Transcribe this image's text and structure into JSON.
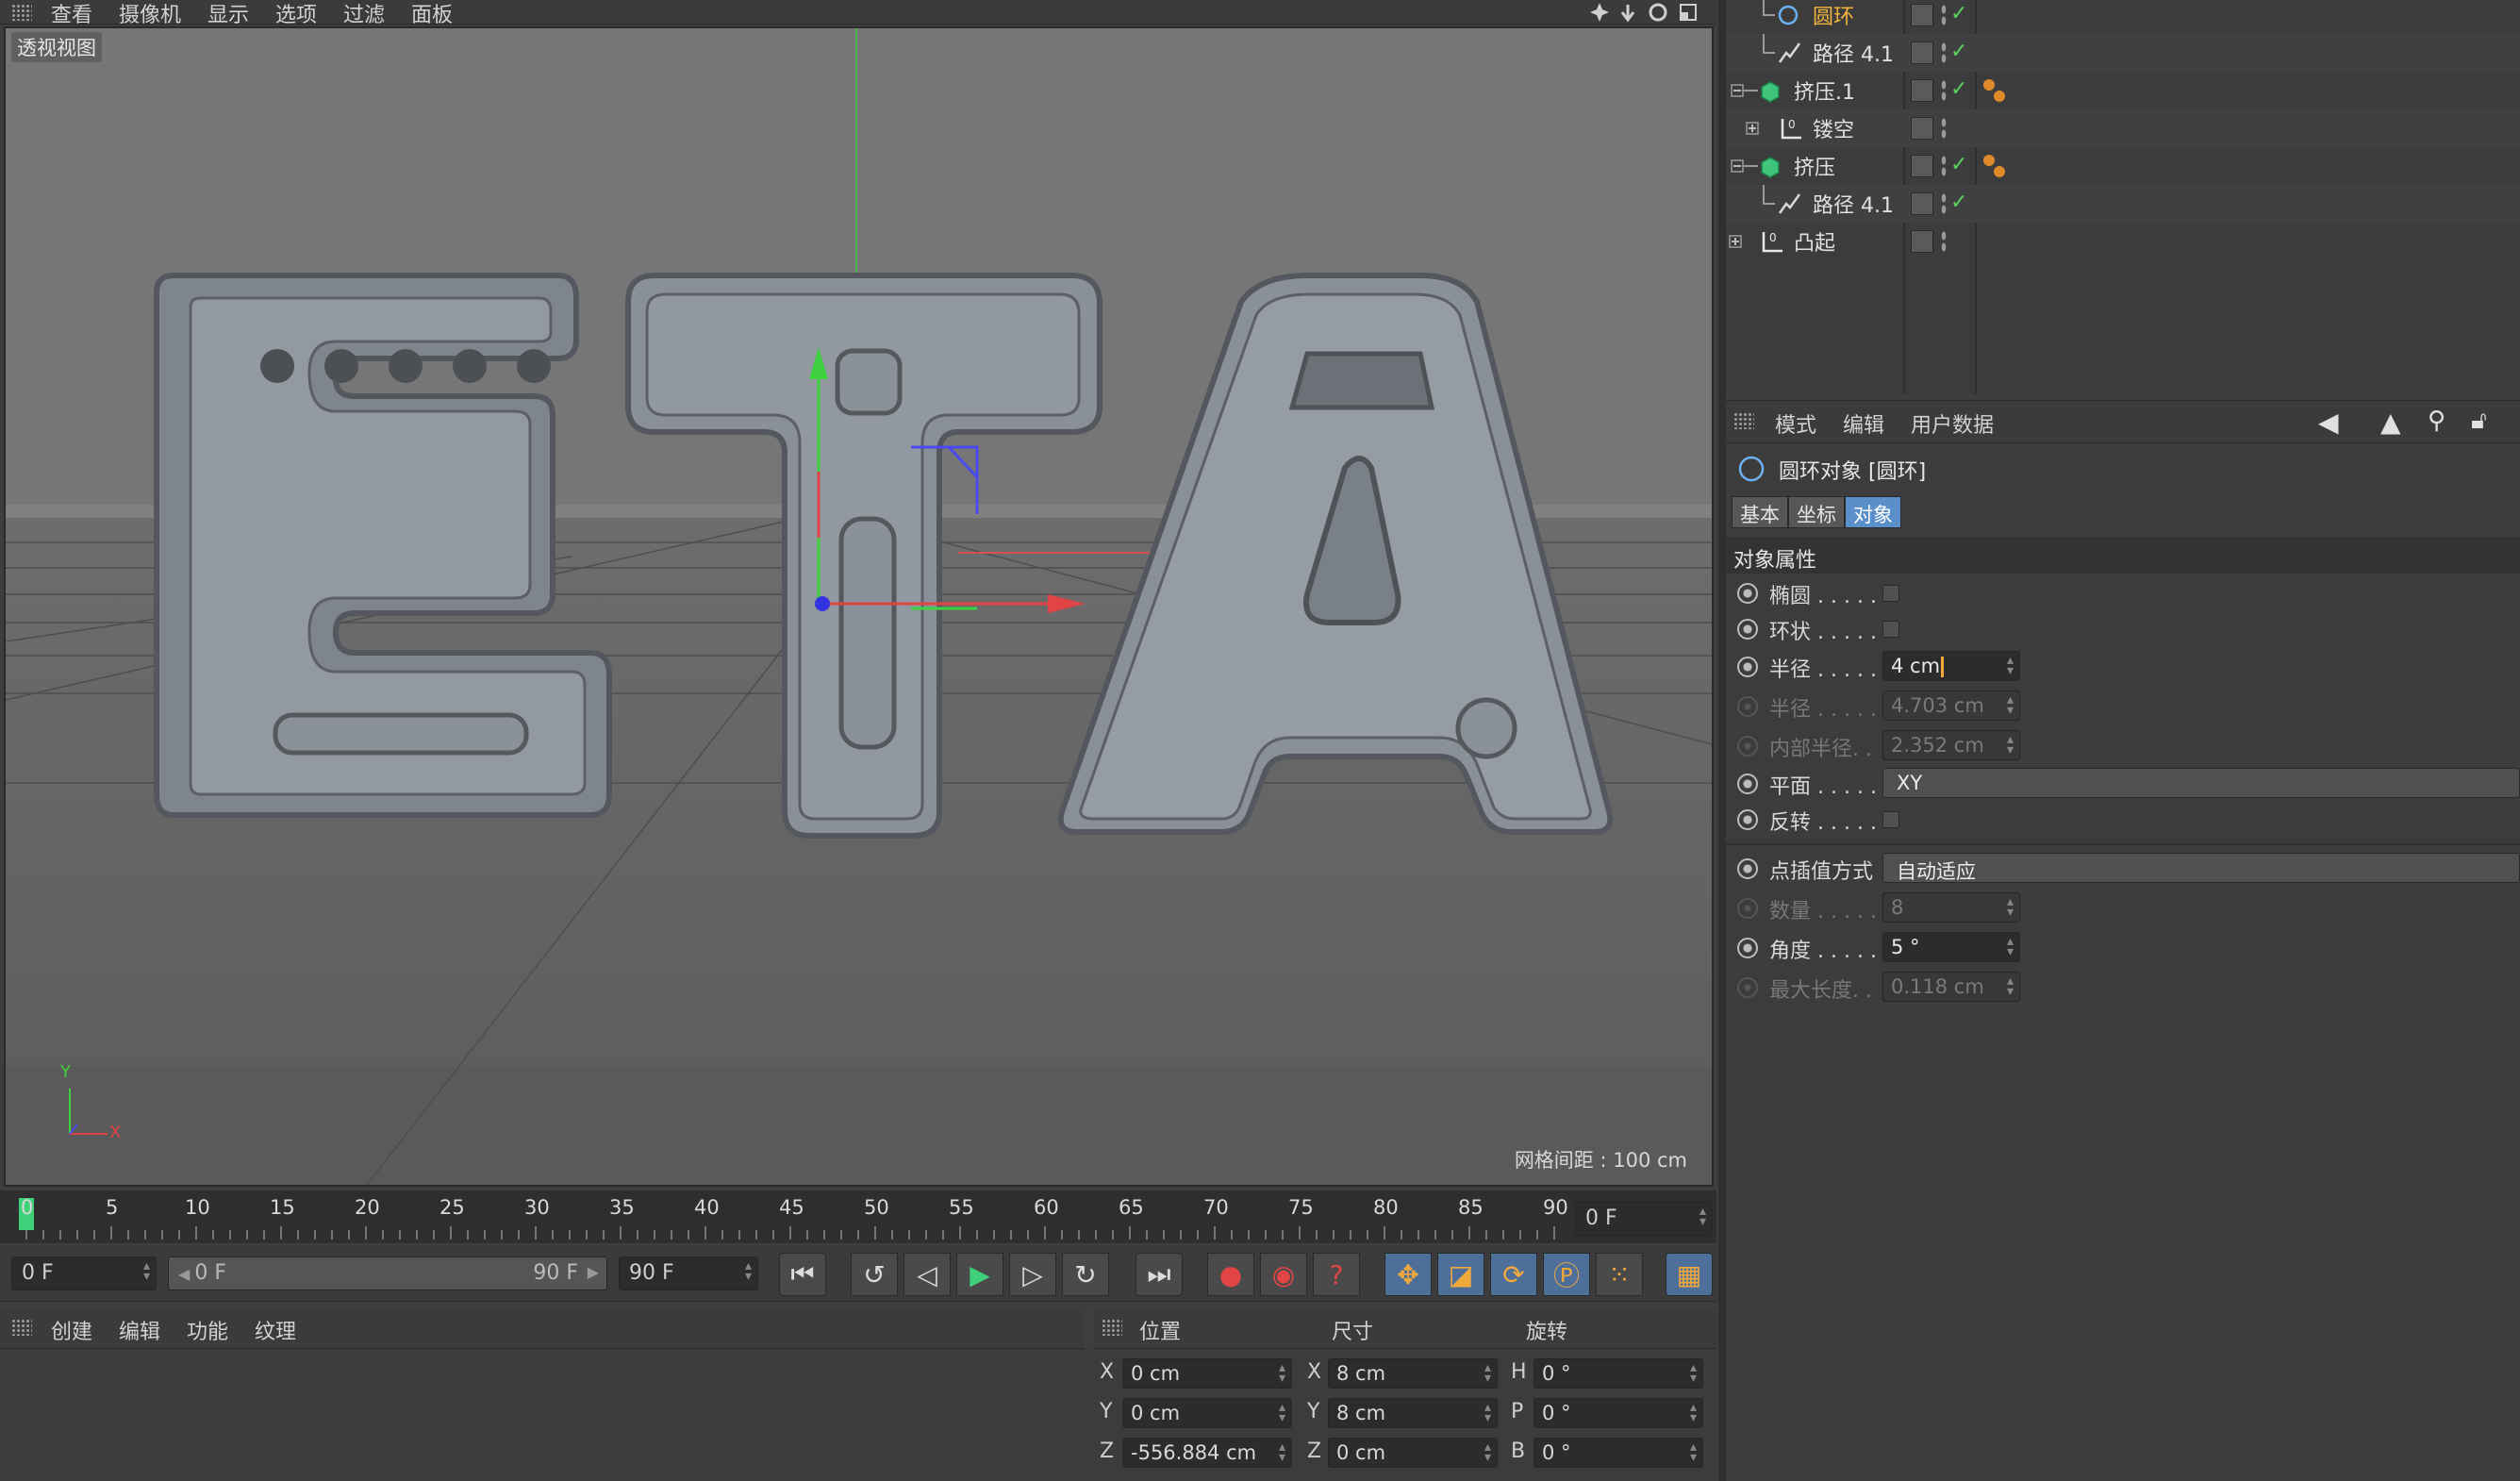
{
  "menubar": {
    "items": [
      "查看",
      "摄像机",
      "显示",
      "选项",
      "过滤",
      "面板"
    ]
  },
  "viewport": {
    "label": "透视视图",
    "grid_spacing": "网格间距 : 100 cm",
    "letters": "ETA",
    "axis": {
      "y": "Y",
      "x": "X"
    }
  },
  "timeline": {
    "ticks": [
      "0",
      "5",
      "10",
      "15",
      "20",
      "25",
      "30",
      "35",
      "40",
      "45",
      "50",
      "55",
      "60",
      "65",
      "70",
      "75",
      "80",
      "85",
      "90"
    ],
    "current_frame": "0 F",
    "start_frame": "0 F",
    "range_start": "0 F",
    "range_end": "90 F",
    "end_frame": "90 F"
  },
  "materials": {
    "menu": [
      "创建",
      "编辑",
      "功能",
      "纹理"
    ]
  },
  "coords": {
    "headers": {
      "position": "位置",
      "size": "尺寸",
      "rotation": "旋转"
    },
    "rows": [
      {
        "axis": "X",
        "pos": "0 cm",
        "size_axis": "X",
        "size": "8 cm",
        "rot_axis": "H",
        "rot": "0 °"
      },
      {
        "axis": "Y",
        "pos": "0 cm",
        "size_axis": "Y",
        "size": "8 cm",
        "rot_axis": "P",
        "rot": "0 °"
      },
      {
        "axis": "Z",
        "pos": "-556.884 cm",
        "size_axis": "Z",
        "size": "0 cm",
        "rot_axis": "B",
        "rot": "0 °"
      }
    ]
  },
  "objects": [
    {
      "name": "圆环",
      "selected": true
    },
    {
      "name": "路径 4.1"
    },
    {
      "name": "挤压.1"
    },
    {
      "name": "镂空"
    },
    {
      "name": "挤压"
    },
    {
      "name": "路径 4.1"
    },
    {
      "name": "凸起"
    }
  ],
  "attributes": {
    "menu": [
      "模式",
      "编辑",
      "用户数据"
    ],
    "object_title": "圆环对象 [圆环]",
    "tabs": [
      "基本",
      "坐标",
      "对象"
    ],
    "section": "对象属性",
    "rows": [
      {
        "label": "椭圆 . . . . .",
        "type": "checkbox"
      },
      {
        "label": "环状 . . . . .",
        "type": "checkbox"
      },
      {
        "label": "半径 . . . . .",
        "value": "4 cm",
        "type": "field"
      },
      {
        "label": "半径 . . . . .",
        "value": "4.703 cm",
        "type": "field",
        "dim": true
      },
      {
        "label": "内部半径. .",
        "value": "2.352 cm",
        "type": "field",
        "dim": true
      },
      {
        "label": "平面 . . . . .",
        "value": "XY",
        "type": "wide"
      },
      {
        "label": "反转 . . . . .",
        "type": "checkbox"
      },
      {
        "label": "点插值方式",
        "value": "自动适应",
        "type": "wide"
      },
      {
        "label": "数量 . . . . .",
        "value": "8",
        "type": "field",
        "dim": true
      },
      {
        "label": "角度 . . . . .",
        "value": "5 °",
        "type": "field"
      },
      {
        "label": "最大长度. .",
        "value": "0.118 cm",
        "type": "field",
        "dim": true
      }
    ]
  },
  "colors": {
    "accent": "#5b8fc9",
    "selected_text": "#f2b43c",
    "check": "#5ad35a",
    "play": "#3fd07a"
  }
}
